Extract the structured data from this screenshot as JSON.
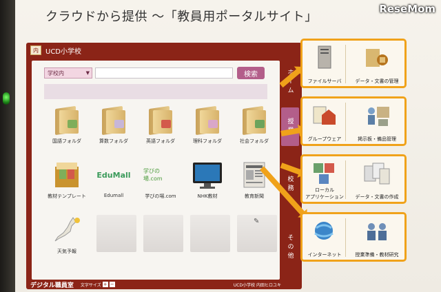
{
  "slide": {
    "title": "クラウドから提供 ～「教員用ポータルサイト」"
  },
  "watermark": "ReseMom",
  "app": {
    "school_name": "UCD小学校",
    "logo_text": "内",
    "search": {
      "scope": "学校内",
      "placeholder": "",
      "button": "検索"
    },
    "tiles": [
      {
        "label": "国語フォルダ",
        "icon": "folder-icon",
        "badge": "#7fae5a"
      },
      {
        "label": "算数フォルダ",
        "icon": "folder-icon",
        "badge": "#c7b6d8"
      },
      {
        "label": "英語フォルダ",
        "icon": "folder-icon",
        "badge": "#d35a4b"
      },
      {
        "label": "理科フォルダ",
        "icon": "folder-icon",
        "badge": "#d9a7c8"
      },
      {
        "label": "社会フォルダ",
        "icon": "folder-icon",
        "badge": "#6ca35c"
      },
      {
        "label": "教材テンプレート",
        "icon": "template-box-icon"
      },
      {
        "label": "Edumall",
        "icon": "edumall-logo",
        "logo_text": "EduMall"
      },
      {
        "label": "学びの場.com",
        "icon": "manabi-logo",
        "logo_text": "学びの場.com"
      },
      {
        "label": "NHK教材",
        "icon": "tv-icon"
      },
      {
        "label": "教育新聞",
        "icon": "newspaper-icon"
      },
      {
        "label": "天気予報",
        "icon": "japan-weather-map-icon"
      }
    ],
    "tabs": [
      {
        "label": "ホーム",
        "color": "#8b2417"
      },
      {
        "label": "授業",
        "color": "#b35e8a"
      },
      {
        "label": "校務",
        "color": "#8b2417"
      },
      {
        "label": "その他",
        "color": "#8b2417"
      }
    ],
    "footer": {
      "app_name": "デジタル職員室",
      "text_size": "文字サイズ",
      "plus": "+",
      "minus": "−",
      "user": "UCD小学校 内田ヒロユキ"
    }
  },
  "features": [
    {
      "left_label": "ファイルサーバ",
      "right_label": "データ・文書の管理",
      "left_icon": "server-icon",
      "right_icon": "documents-lock-icon"
    },
    {
      "left_label": "グループウェア",
      "right_label": "掲示板・備品管理",
      "left_icon": "groupware-icon",
      "right_icon": "people-equipment-icon"
    },
    {
      "left_label": "ローカル\nアプリケーション",
      "right_label": "データ・文書の作成",
      "left_icon": "local-apps-icon",
      "right_icon": "document-creation-icon"
    },
    {
      "left_label": "インターネット",
      "right_label": "授業準備・教材研究",
      "left_icon": "internet-globe-icon",
      "right_icon": "meeting-people-icon"
    }
  ],
  "colors": {
    "accent": "#f0a21a",
    "app_frame": "#8b2417",
    "tab_active": "#b35e8a"
  }
}
